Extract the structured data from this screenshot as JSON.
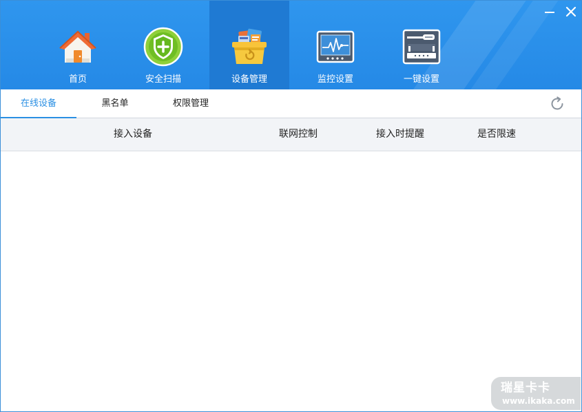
{
  "nav": {
    "items": [
      {
        "label": "首页",
        "icon": "home-icon"
      },
      {
        "label": "安全扫描",
        "icon": "shield-plus-icon"
      },
      {
        "label": "设备管理",
        "icon": "device-box-icon"
      },
      {
        "label": "监控设置",
        "icon": "monitor-icon"
      },
      {
        "label": "一键设置",
        "icon": "router-settings-icon"
      }
    ],
    "active": "设备管理"
  },
  "window_controls": {
    "minimize": "minimize-icon",
    "close": "close-icon"
  },
  "subtabs": {
    "items": [
      {
        "label": "在线设备"
      },
      {
        "label": "黑名单"
      },
      {
        "label": "权限管理"
      }
    ],
    "active": "在线设备",
    "refresh_icon": "refresh-icon"
  },
  "table": {
    "columns": [
      "接入设备",
      "联网控制",
      "接入时提醒",
      "是否限速"
    ],
    "rows": []
  },
  "watermark": {
    "title": "瑞星卡卡",
    "url": "www.ikaka.com"
  },
  "colors": {
    "primary": "#2589e6",
    "active_tab": "#1f7ad3",
    "accent": "#2a8fe3"
  }
}
